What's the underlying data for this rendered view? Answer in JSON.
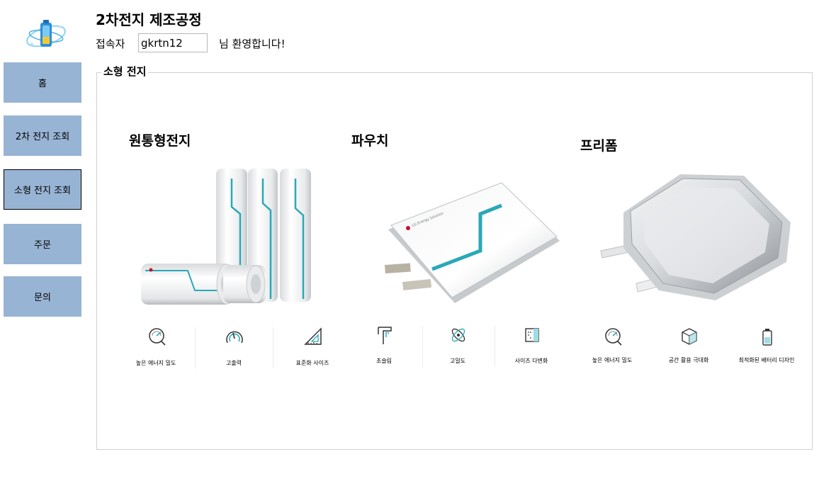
{
  "header": {
    "title": "2차전지 제조공정",
    "user_label": "접속자",
    "user_id": "gkrtn12",
    "welcome_text": "님 환영합니다!"
  },
  "logo": {
    "icon": "battery-logo-icon"
  },
  "sidebar": {
    "items": [
      {
        "label": "홈"
      },
      {
        "label": "2차 전지 조회"
      },
      {
        "label": "소형 전지 조회",
        "active": true
      },
      {
        "label": "주문"
      },
      {
        "label": "문의"
      }
    ]
  },
  "group": {
    "legend": "소형 전지",
    "categories": [
      {
        "title": "원통형전지",
        "image": "cylindrical-battery",
        "features": [
          {
            "label": "높은 에너지 밀도",
            "icon": "energy-density-icon"
          },
          {
            "label": "고출력",
            "icon": "power-gauge-icon"
          },
          {
            "label": "표준화 사이즈",
            "icon": "set-square-icon"
          }
        ]
      },
      {
        "title": "파우치",
        "image": "pouch-battery",
        "features": [
          {
            "label": "초슬림",
            "icon": "caliper-icon"
          },
          {
            "label": "고밀도",
            "icon": "atom-icon"
          },
          {
            "label": "사이즈 다변화",
            "icon": "size-grid-icon"
          }
        ]
      },
      {
        "title": "프리폼",
        "image": "freeform-battery",
        "features": [
          {
            "label": "높은 에너지 밀도",
            "icon": "energy-density-icon"
          },
          {
            "label": "공간 활용 극대화",
            "icon": "cube-icon"
          },
          {
            "label": "최적화된 배터리 디자인",
            "icon": "battery-design-icon"
          }
        ]
      }
    ]
  },
  "colors": {
    "nav_button": "#98b4d4",
    "accent_teal": "#2aa8b8",
    "brand_red": "#c8102e"
  }
}
